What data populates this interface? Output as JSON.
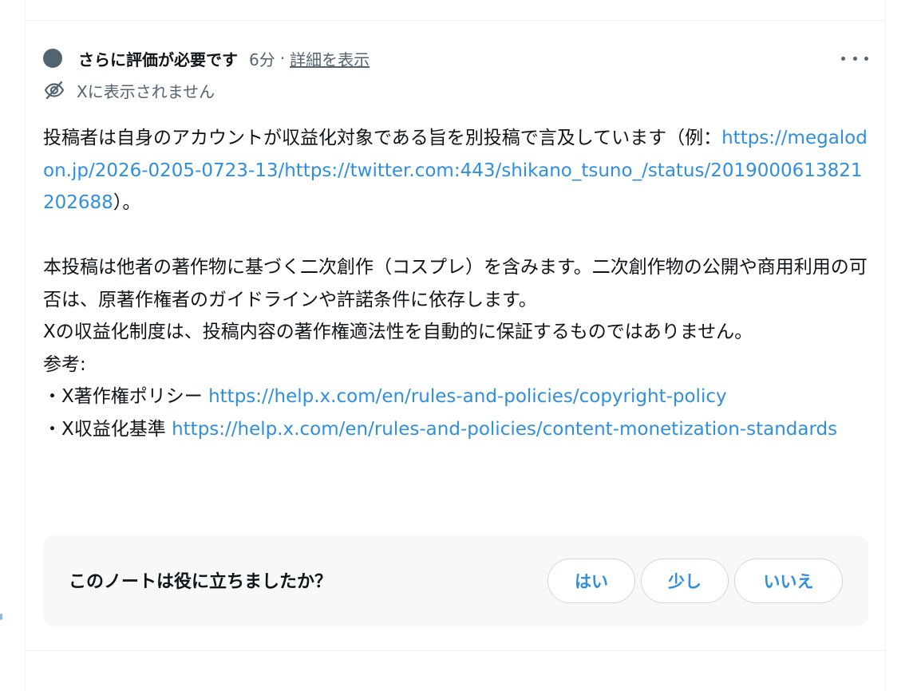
{
  "note": {
    "status_title": "さらに評価が必要です",
    "time_ago": "6分",
    "separator": "·",
    "details_link": "詳細を表示",
    "visibility_text": "Xに表示されません",
    "body": {
      "line1_text": "投稿者は自身のアカウントが収益化対象である旨を別投稿で言及しています（例：",
      "line1_link": "https://megalodon.jp/2026-0205-0723-13/https://twitter.com:443/shikano_tsuno_/status/2019000613821202688",
      "line1_end": "）。",
      "para2": "本投稿は他者の著作物に基づく二次創作（コスプレ）を含みます。二次創作物の公開や商用利用の可否は、原著作権者のガイドラインや許諾条件に依存します。",
      "para3": "Xの収益化制度は、投稿内容の著作権適法性を自動的に保証するものではありません。",
      "ref_label": "参考:",
      "ref1_label": "・X著作権ポリシー ",
      "ref1_link": "https://help.x.com/en/rules-and-policies/copyright-policy",
      "ref2_label": "・X収益化基準 ",
      "ref2_link": "https://help.x.com/en/rules-and-policies/content-monetization-standards"
    }
  },
  "helpful": {
    "question": "このノートは役に立ちましたか？",
    "yes": "はい",
    "somewhat": "少し",
    "no": "いいえ"
  },
  "colors": {
    "link": "#2f8fde",
    "muted": "#536471",
    "text": "#0f1419",
    "panel": "#f7f9f9"
  }
}
